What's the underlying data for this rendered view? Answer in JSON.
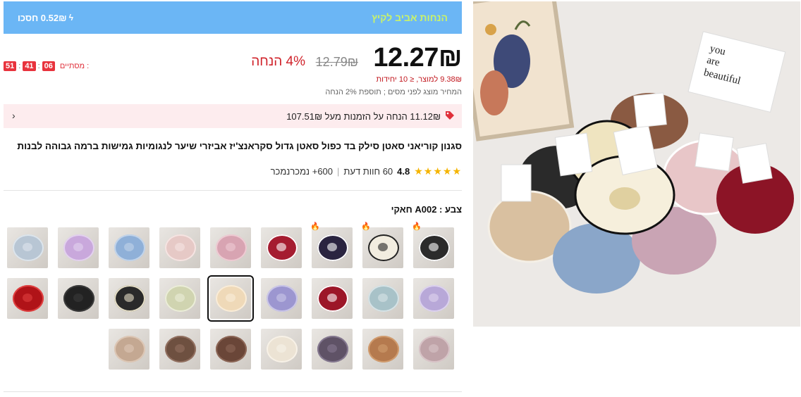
{
  "banner": {
    "title": "הנחות אביב לקיץ",
    "saving": "0.52₪ חסכו"
  },
  "price": {
    "current": "12.27₪",
    "original": "12.79₪",
    "discount": "4% הנחה"
  },
  "countdown": {
    "label": "מסתיים :",
    "hours": "06",
    "minutes": "41",
    "seconds": "51"
  },
  "unit_price": "9.38₪ למוצר, ≤ 10 יחידות",
  "tax_note": "המחיר מוצג לפני מסים ; תוספת 2% הנחה",
  "coupon": {
    "text": "11.12₪ הנחה על הזמנות מעל 107.51₪"
  },
  "product": {
    "title": "סגנון קוריאני סאטן סילק בד כפול סאטן גדול סקראנצ'יז אביזרי שיער לנגומיות גמישות ברמה גבוהה לבנות",
    "rating": "4.8",
    "reviews": "60 חוות דעת",
    "sold": "600+ נמכרנמכר"
  },
  "color": {
    "label": "צבע : A002 חאקי"
  },
  "swatches": [
    {
      "color": "#2b2b2b",
      "accent": "#ffffff",
      "hot": true
    },
    {
      "color": "#f2ede0",
      "accent": "#222222",
      "hot": true
    },
    {
      "color": "#2a2440",
      "accent": "#ffffff",
      "hot": true
    },
    {
      "color": "#a51c30",
      "accent": "#ffffff",
      "hot": false
    },
    {
      "color": "#d8a4b2",
      "accent": "#eecbd3",
      "hot": false
    },
    {
      "color": "#e6c9c6",
      "accent": "#f5e4e2",
      "hot": false
    },
    {
      "color": "#8fb0d8",
      "accent": "#c2d4ea",
      "hot": false
    },
    {
      "color": "#c9a8dc",
      "accent": "#e3d2ee",
      "hot": false
    },
    {
      "color": "#b8c6d4",
      "accent": "#dde5ec",
      "hot": false
    },
    {
      "color": "#b8a8d8",
      "accent": "#ddd3ee",
      "hot": false
    },
    {
      "color": "#a8c2c8",
      "accent": "#d7e3e6",
      "hot": false
    },
    {
      "color": "#9c1628",
      "accent": "#ffffff",
      "hot": false
    },
    {
      "color": "#9c96d0",
      "accent": "#cac6e8",
      "hot": false
    },
    {
      "color": "#efd9b8",
      "accent": "#f9ecd8",
      "hot": false,
      "selected": true
    },
    {
      "color": "#d0d4b0",
      "accent": "#ebedd9",
      "hot": false
    },
    {
      "color": "#2a2a2a",
      "accent": "#e7e0c8",
      "hot": false
    },
    {
      "color": "#222222",
      "accent": "#3a3a3a",
      "hot": false
    },
    {
      "color": "#b01318",
      "accent": "#e04040",
      "hot": false
    },
    {
      "color": "#bfa3a8",
      "accent": "#d9c4c8",
      "hot": false
    },
    {
      "color": "#b57a4e",
      "accent": "#d19c6e",
      "hot": false
    },
    {
      "color": "#5f5266",
      "accent": "#857890",
      "hot": false
    },
    {
      "color": "#ece3d4",
      "accent": "#f7f1e7",
      "hot": false
    },
    {
      "color": "#6a4638",
      "accent": "#8c6656",
      "hot": false
    },
    {
      "color": "#6e5040",
      "accent": "#927060",
      "hot": false
    },
    {
      "color": "#c4a892",
      "accent": "#ddc7b5",
      "hot": false
    }
  ],
  "hero_image": {
    "card_text_line1": "you",
    "card_text_line2": "are",
    "card_text_line3": "beautiful"
  }
}
